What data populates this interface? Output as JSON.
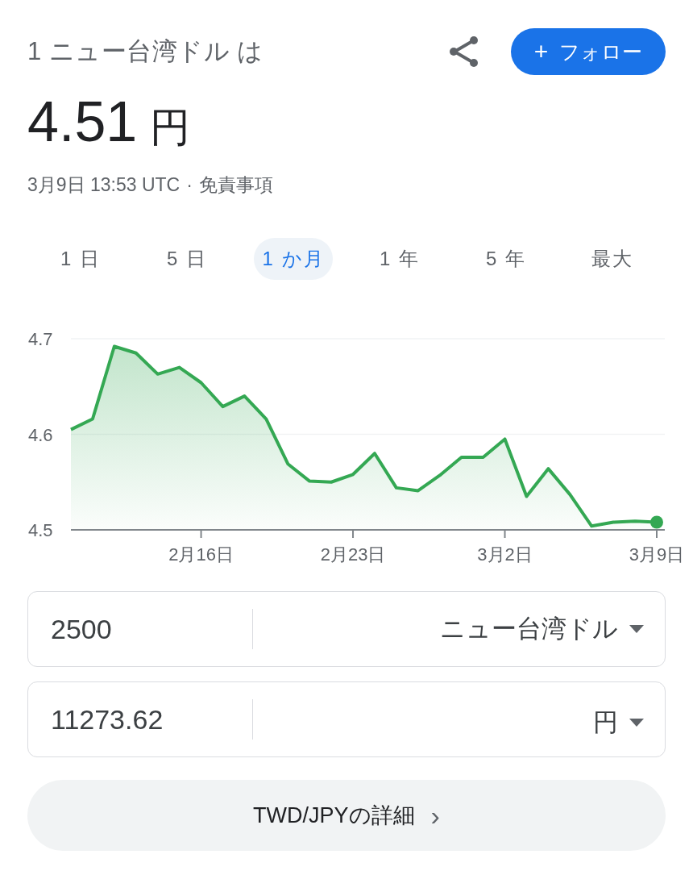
{
  "header": {
    "title": "1 ニュー台湾ドル は",
    "follow_button": {
      "icon": "+",
      "label": "フォロー"
    }
  },
  "rate": {
    "value": "4.51",
    "unit": "円"
  },
  "meta": {
    "timestamp": "3月9日 13:53 UTC",
    "separator": "·",
    "disclaimer": "免責事項"
  },
  "tabs": [
    {
      "label": "1 日",
      "selected": false
    },
    {
      "label": "5 日",
      "selected": false
    },
    {
      "label": "1 か月",
      "selected": true
    },
    {
      "label": "1 年",
      "selected": false
    },
    {
      "label": "5 年",
      "selected": false
    },
    {
      "label": "最大",
      "selected": false
    }
  ],
  "chart": {
    "chart_data": {
      "type": "area",
      "ylim": [
        4.5,
        4.7
      ],
      "yticks": [
        4.5,
        4.6,
        4.7
      ],
      "categories": [
        null,
        null,
        null,
        null,
        null,
        null,
        "2月16日",
        null,
        null,
        null,
        null,
        null,
        null,
        "2月23日",
        null,
        null,
        null,
        null,
        null,
        null,
        "3月2日",
        null,
        null,
        null,
        null,
        null,
        null,
        "3月9日"
      ],
      "series": [
        {
          "color": "#34a853",
          "values": [
            4.605,
            4.616,
            4.692,
            4.685,
            4.663,
            4.67,
            4.654,
            4.629,
            4.64,
            4.616,
            4.569,
            4.551,
            4.55,
            4.558,
            4.58,
            4.544,
            4.541,
            4.557,
            4.576,
            4.576,
            4.595,
            4.535,
            4.564,
            4.537,
            4.504,
            4.508,
            4.509,
            4.508
          ]
        }
      ]
    }
  },
  "converter": [
    {
      "amount": "2500",
      "currency": "ニュー台湾ドル"
    },
    {
      "amount": "11273.62",
      "currency": "円"
    }
  ],
  "details_button": {
    "label": "TWD/JPYの詳細",
    "icon": "›"
  }
}
